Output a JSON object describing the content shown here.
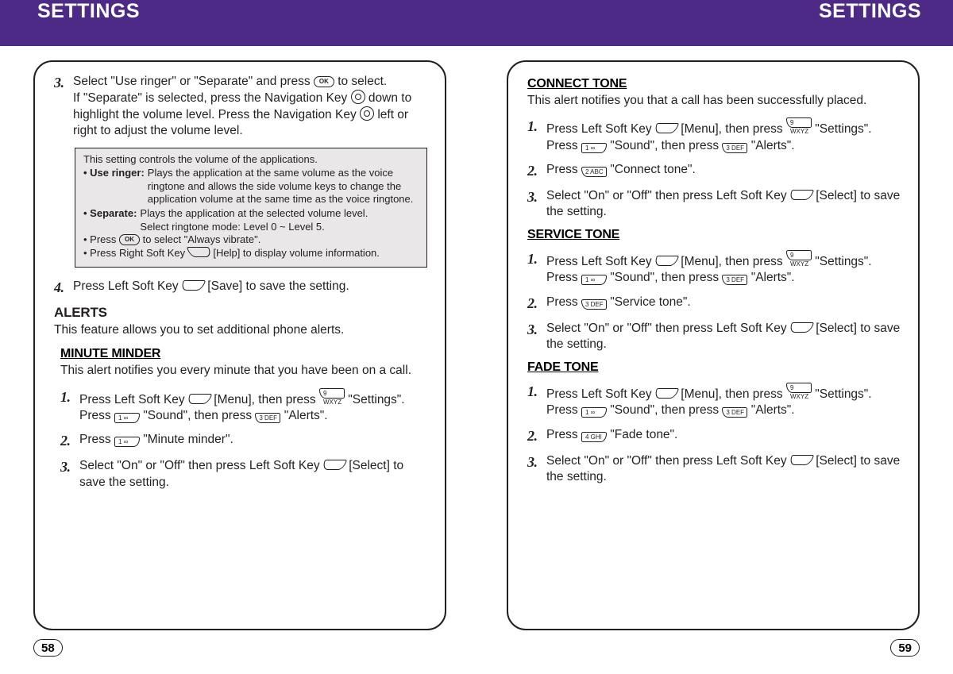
{
  "banner": {
    "left": "SETTINGS",
    "right": "SETTINGS"
  },
  "left_page": {
    "page_number": "58",
    "step3": {
      "num": "3.",
      "line1a": "Select \"Use ringer\" or \"Separate\" and press ",
      "line1b": " to select.",
      "line2a": "If \"Separate\" is selected, press the Navigation Key ",
      "line2b": " down to highlight the volume level. Press the Navigation Key ",
      "line2c": " left or right to adjust the volume level."
    },
    "note": {
      "line1": "This setting controls the volume of the applications.",
      "use_ringer_label": "• Use ringer:",
      "use_ringer_text": "Plays the application at the same volume as the voice ringtone and allows the side volume keys to change the application volume at the same time as the voice ringtone.",
      "separate_label": "• Separate:",
      "separate_text1": "Plays the application at the selected volume level.",
      "separate_text2": "Select ringtone mode: Level 0 ~ Level 5.",
      "press_ok_a": "• Press ",
      "press_ok_b": " to select \"Always vibrate\".",
      "press_rsk_a": "• Press Right Soft Key ",
      "press_rsk_b": " [Help] to display volume information."
    },
    "step4": {
      "num": "4.",
      "a": "Press Left Soft Key ",
      "b": " [Save] to save the setting."
    },
    "alerts": {
      "heading": "ALERTS",
      "desc": "This feature allows you to set additional phone alerts."
    },
    "minute": {
      "heading": "MINUTE MINDER",
      "desc": "This alert notifies you every minute that you have been on a call.",
      "s1": {
        "num": "1.",
        "a": "Press Left Soft Key ",
        "b": " [Menu], then press ",
        "c": " \"Settings\". Press ",
        "d": " \"Sound\", then press ",
        "e": " \"Alerts\"."
      },
      "s2": {
        "num": "2.",
        "a": "Press ",
        "b": " \"Minute minder\"."
      },
      "s3": {
        "num": "3.",
        "a": "Select \"On\" or \"Off\" then press Left Soft Key ",
        "b": " [Select] to save the setting."
      }
    }
  },
  "right_page": {
    "page_number": "59",
    "connect": {
      "heading": "CONNECT TONE",
      "desc": "This alert notifies you that a call has been successfully placed.",
      "s1": {
        "num": "1.",
        "a": "Press Left Soft Key ",
        "b": " [Menu], then press ",
        "c": " \"Settings\". Press ",
        "d": " \"Sound\", then press ",
        "e": " \"Alerts\"."
      },
      "s2": {
        "num": "2.",
        "a": "Press ",
        "b": " \"Connect tone\"."
      },
      "s3": {
        "num": "3.",
        "a": "Select \"On\" or \"Off\" then press Left Soft Key ",
        "b": " [Select] to save the setting."
      }
    },
    "service": {
      "heading": "SERVICE TONE",
      "s1": {
        "num": "1.",
        "a": "Press Left Soft Key ",
        "b": " [Menu], then press ",
        "c": " \"Settings\". Press ",
        "d": " \"Sound\", then press ",
        "e": " \"Alerts\"."
      },
      "s2": {
        "num": "2.",
        "a": "Press ",
        "b": " \"Service tone\"."
      },
      "s3": {
        "num": "3.",
        "a": "Select \"On\" or \"Off\" then press Left Soft Key ",
        "b": " [Select] to save the setting."
      }
    },
    "fade": {
      "heading": "FADE TONE",
      "s1": {
        "num": "1.",
        "a": "Press Left Soft Key ",
        "b": " [Menu], then press ",
        "c": " \"Settings\". Press ",
        "d": " \"Sound\", then press ",
        "e": " \"Alerts\"."
      },
      "s2": {
        "num": "2.",
        "a": "Press ",
        "b": " \"Fade tone\"."
      },
      "s3": {
        "num": "3.",
        "a": "Select \"On\" or \"Off\" then press Left Soft Key ",
        "b": " [Select] to save the setting."
      }
    }
  },
  "keys": {
    "ok": "OK",
    "k1": "1 ∞",
    "k2": "2 ABC",
    "k3": "3 DEF",
    "k4": "4 GHI",
    "k9": "9 WXYZ"
  }
}
